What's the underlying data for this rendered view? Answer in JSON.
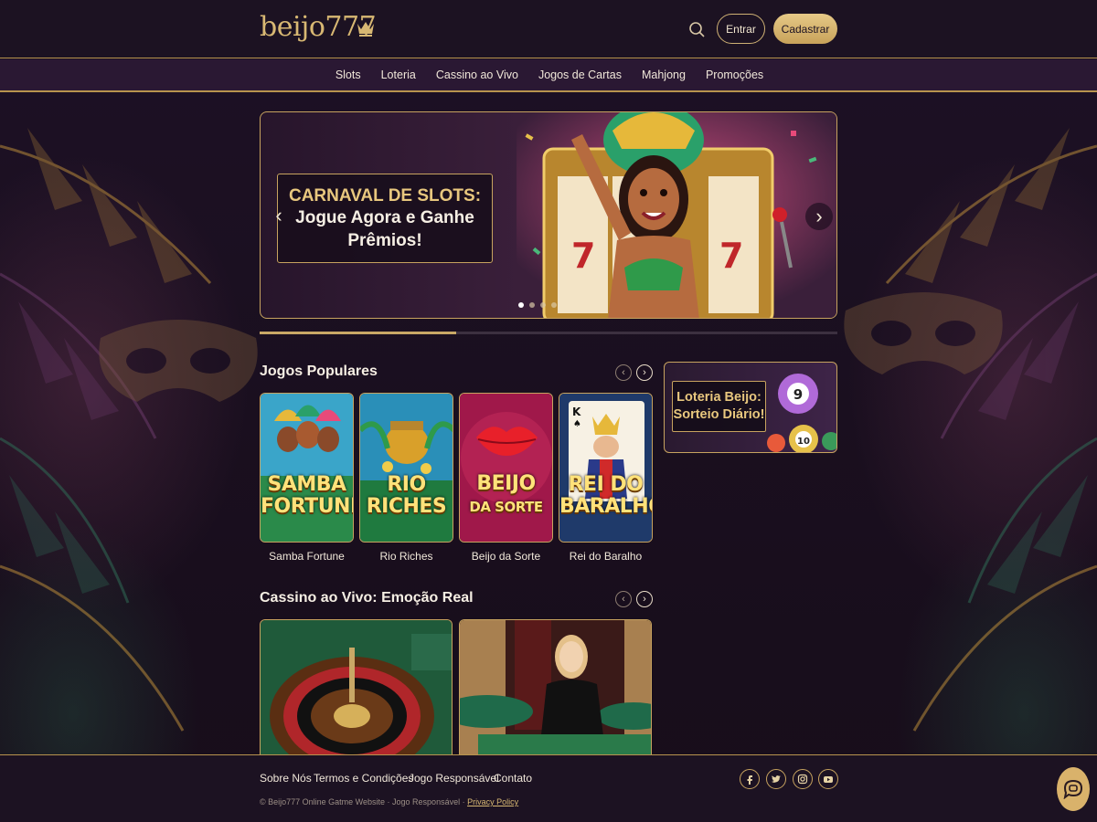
{
  "header": {
    "logo": "beijo777",
    "login_label": "Entrar",
    "register_label": "Cadastrar"
  },
  "nav": {
    "items": [
      "Slots",
      "Loteria",
      "Cassino ao Vivo",
      "Jogos de Cartas",
      "Mahjong",
      "Promoções"
    ]
  },
  "hero": {
    "title_line1": "CARNAVAL DE SLOTS:",
    "title_line2": "Jogue Agora e Ganhe Prêmios!",
    "slide_count": 4,
    "active_slide": 1,
    "progress": 0.34
  },
  "popular": {
    "title": "Jogos Populares",
    "games": [
      {
        "name": "Samba Fortune",
        "art_text": "SAMBA FORTUNE"
      },
      {
        "name": "Rio Riches",
        "art_text": "RIO RICHES"
      },
      {
        "name": "Beijo da Sorte",
        "art_text": "BEIJO DA SORTE"
      },
      {
        "name": "Rei do Baralho",
        "art_text": "REI DO BARALHO"
      }
    ]
  },
  "lottery": {
    "text": "Loteria Beijo: Sorteio Diário!",
    "balls": [
      "9",
      "10"
    ]
  },
  "live": {
    "title": "Cassino ao Vivo: Emoção Real"
  },
  "footer": {
    "links": [
      "Sobre Nós",
      "Termos e Condições",
      "Jogo Responsável",
      "Contato"
    ],
    "copyright": "© Beijo777 Online Gatme Website · Jogo Responsável ·",
    "privacy": "Privacy Policy"
  },
  "colors": {
    "gold": "#c7a35f",
    "background": "#1a1020",
    "nav_bg": "#2a1833"
  }
}
